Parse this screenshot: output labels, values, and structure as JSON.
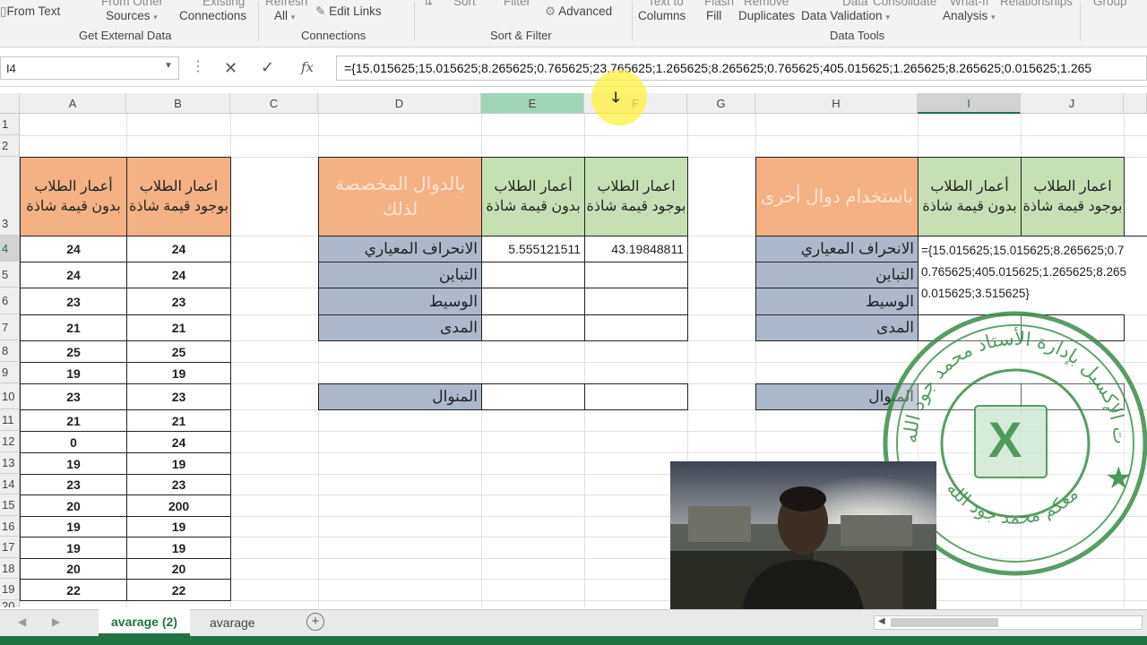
{
  "ribbon": {
    "get_external_data": {
      "from_other_sources_top": "From Other",
      "from_other_sources": "Sources",
      "existing_top": "Existing",
      "existing_connections": "Connections",
      "from_text": "From Text",
      "group_label": "Get External Data"
    },
    "connections": {
      "refresh_top": "Refresh",
      "refresh_all": "All",
      "edit_links": "Edit Links",
      "group_label": "Connections"
    },
    "sort_filter": {
      "sort": "Sort",
      "filter": "Filter",
      "advanced": "Advanced",
      "group_label": "Sort & Filter"
    },
    "data_tools": {
      "text_to_top": "Text to",
      "text_to_columns": "Columns",
      "flash_top": "Flash",
      "flash_fill": "Fill",
      "remove_top": "Remove",
      "remove_duplicates": "Duplicates",
      "data_top": "Data",
      "data_validation": "Data Validation",
      "consolidate": "Consolidate",
      "what_if_top": "What-If",
      "what_if_analysis": "Analysis",
      "relationships": "Relationships",
      "group_top": "Group",
      "group_label": "Data Tools"
    }
  },
  "formula_bar": {
    "name_box": "I4",
    "formula": "={15.015625;15.015625;8.265625;0.765625;23.765625;1.265625;8.265625;0.765625;405.015625;1.265625;8.265625;0.015625;1.265"
  },
  "columns": [
    "A",
    "B",
    "C",
    "D",
    "E",
    "F",
    "G",
    "H",
    "I",
    "J"
  ],
  "rows": [
    "1",
    "2",
    "3",
    "4",
    "5",
    "6",
    "7",
    "8",
    "9",
    "10",
    "11",
    "12",
    "13",
    "14",
    "15",
    "16",
    "17",
    "18",
    "19",
    "20"
  ],
  "table_ab": {
    "header_a": "أعمار الطلاب بدون قيمة شاذة",
    "header_b": "اعمار الطلاب بوجود قيمة شاذة",
    "values_a": [
      "24",
      "24",
      "23",
      "21",
      "25",
      "19",
      "23",
      "21",
      "0",
      "19",
      "23",
      "20",
      "19",
      "19",
      "20",
      "22"
    ],
    "values_b": [
      "24",
      "24",
      "23",
      "21",
      "25",
      "19",
      "23",
      "21",
      "24",
      "19",
      "23",
      "200",
      "19",
      "19",
      "20",
      "22"
    ]
  },
  "table_def": {
    "header_d": "بالدوال المخصصة لذلك",
    "header_e": "أعمار الطلاب بدون قيمة شاذة",
    "header_f": "اعمار الطلاب بوجود قيمة شاذة",
    "labels": [
      "الانحراف المعياري",
      "التباين",
      "الوسيط",
      "المدى"
    ],
    "stdev_e": "5.555121511",
    "stdev_f": "43.19848811",
    "mode_label": "المنوال"
  },
  "table_hij": {
    "header_h": "باستخدام دوال أخرى",
    "header_i": "أعمار الطلاب بدون قيمة شاذة",
    "header_j": "اعمار الطلاب بوجود قيمة شاذة",
    "labels": [
      "الانحراف المعياري",
      "التباين",
      "الوسيط",
      "المدى"
    ],
    "i4_line1": "={15.015625;15.015625;8.265625;0.7",
    "i4_line2": "0.765625;405.015625;1.265625;8.265",
    "i4_line3": "0.015625;3.515625}",
    "mode_label": "المنوال"
  },
  "stamp": {
    "top_text": "دورات الإكسيل بإدارة الأستاذ محمد جود الله",
    "bottom_text": "معكم محمد جود الله"
  },
  "tabs": [
    "avarage (2)",
    "avarage"
  ],
  "colors": {
    "excel_green": "#217346",
    "orange_header": "#f4b183",
    "green_header": "#c6e0b4",
    "blue_label": "#adb9ca"
  }
}
